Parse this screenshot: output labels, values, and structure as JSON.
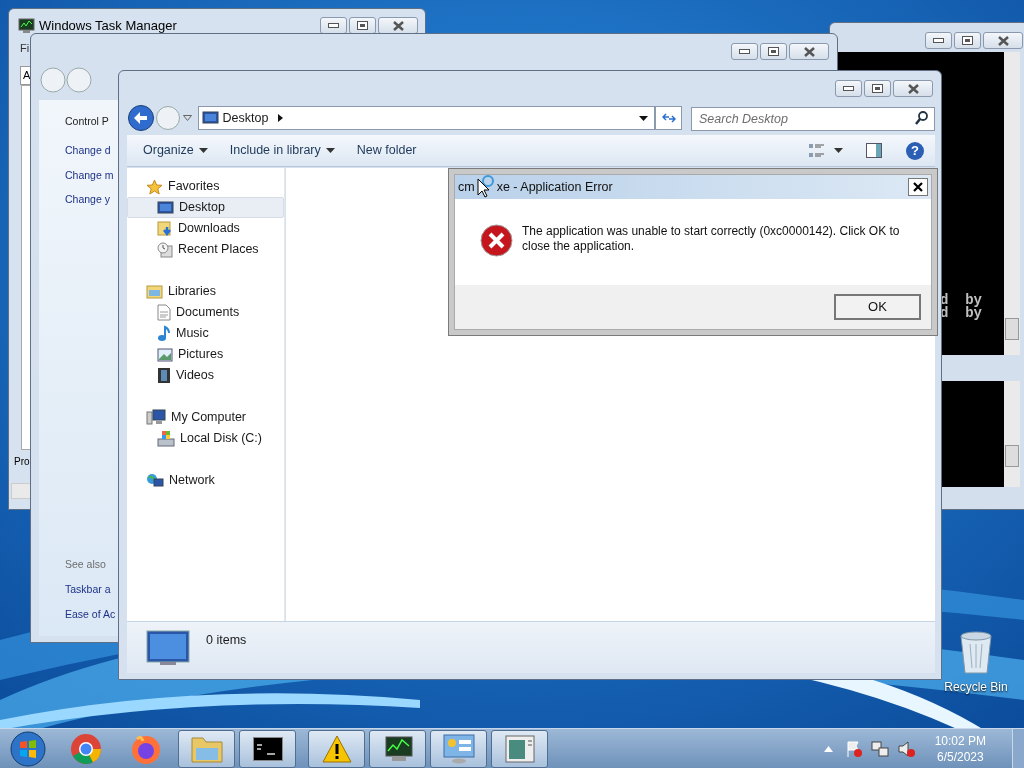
{
  "console": {
    "lines": [
      "d  by",
      "d  by"
    ]
  },
  "task_manager": {
    "title": "Windows Task Manager",
    "menu_fragment": "Fi",
    "tab_fragment": "A",
    "footer_fragment": "Pro"
  },
  "control_panel": {
    "links": [
      "Control P",
      "Change d",
      "Change m",
      "Change y"
    ],
    "see_also_heading": "See also",
    "see_also": [
      "Taskbar a",
      "Ease of Ac"
    ]
  },
  "explorer": {
    "address": "Desktop",
    "search_placeholder": "Search Desktop",
    "toolbar": [
      {
        "label": "Organize",
        "dropdown": true
      },
      {
        "label": "Include in library",
        "dropdown": true
      },
      {
        "label": "New folder",
        "dropdown": false
      }
    ],
    "nav": [
      {
        "label": "Favorites",
        "selected": false,
        "children": [
          {
            "label": "Desktop",
            "selected": true
          },
          {
            "label": "Downloads",
            "selected": false
          },
          {
            "label": "Recent Places",
            "selected": false
          }
        ]
      },
      {
        "label": "Libraries",
        "selected": false,
        "children": [
          {
            "label": "Documents",
            "selected": false
          },
          {
            "label": "Music",
            "selected": false
          },
          {
            "label": "Pictures",
            "selected": false
          },
          {
            "label": "Videos",
            "selected": false
          }
        ]
      },
      {
        "label": "My Computer",
        "selected": false,
        "children": [
          {
            "label": "Local Disk (C:)",
            "selected": false
          }
        ]
      },
      {
        "label": "Network",
        "selected": false
      }
    ],
    "help_glyph": "?",
    "status": "0 items"
  },
  "dialog": {
    "title_parts": [
      "cm",
      "xe - Application Error"
    ],
    "message": "The application was unable to start correctly (0xc0000142). Click OK to close the application.",
    "buttons": [
      "OK"
    ]
  },
  "desktop_icons": [
    {
      "label": "Recycle Bin"
    }
  ],
  "taskbar": {
    "items": [
      {
        "kind": "browser",
        "running": false
      },
      {
        "kind": "browser-alt",
        "running": false
      },
      {
        "kind": "folder",
        "running": true
      },
      {
        "kind": "console",
        "running": true
      },
      {
        "kind": "warning",
        "running": true
      },
      {
        "kind": "monitor",
        "running": true
      },
      {
        "kind": "panel",
        "running": true
      },
      {
        "kind": "document",
        "running": true
      }
    ],
    "time": "10:02 PM",
    "date": "6/5/2023"
  }
}
